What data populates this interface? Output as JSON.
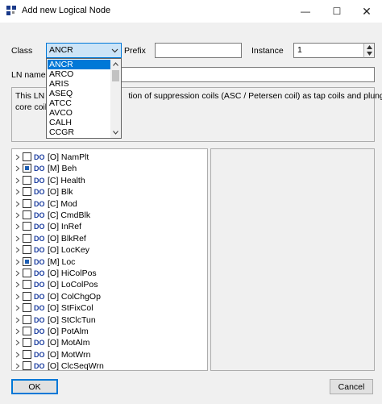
{
  "window": {
    "title": "Add new Logical Node",
    "minimize_glyph": "—",
    "maximize_glyph": "☐",
    "close_glyph": "✕"
  },
  "form": {
    "class_label": "Class",
    "class_value": "ANCR",
    "prefix_label": "Prefix",
    "prefix_value": "",
    "instance_label": "Instance",
    "instance_value": "1",
    "ln_name_label": "LN name",
    "ln_name_value": ""
  },
  "class_dropdown": {
    "options": [
      "ANCR",
      "ARCO",
      "ARIS",
      "ASEQ",
      "ATCC",
      "AVCO",
      "CALH",
      "CCGR"
    ],
    "selected": "ANCR"
  },
  "description": {
    "line1_start": "This LN s",
    "line1_end": "tion of suppression coils (ASC / Petersen coil) as tap coils and plunger",
    "line2": "core coils"
  },
  "tree": {
    "items": [
      {
        "tag": "DO",
        "text": "[O] NamPlt",
        "checked": "none"
      },
      {
        "tag": "DO",
        "text": "[M] Beh",
        "checked": "partial"
      },
      {
        "tag": "DO",
        "text": "[C] Health",
        "checked": "none"
      },
      {
        "tag": "DO",
        "text": "[O] Blk",
        "checked": "none"
      },
      {
        "tag": "DO",
        "text": "[C] Mod",
        "checked": "none"
      },
      {
        "tag": "DO",
        "text": "[C] CmdBlk",
        "checked": "none"
      },
      {
        "tag": "DO",
        "text": "[O] InRef",
        "checked": "none"
      },
      {
        "tag": "DO",
        "text": "[O] BlkRef",
        "checked": "none"
      },
      {
        "tag": "DO",
        "text": "[O] LocKey",
        "checked": "none"
      },
      {
        "tag": "DO",
        "text": "[M] Loc",
        "checked": "partial"
      },
      {
        "tag": "DO",
        "text": "[O] HiColPos",
        "checked": "none"
      },
      {
        "tag": "DO",
        "text": "[O] LoColPos",
        "checked": "none"
      },
      {
        "tag": "DO",
        "text": "[O] ColChgOp",
        "checked": "none"
      },
      {
        "tag": "DO",
        "text": "[O] StFixCol",
        "checked": "none"
      },
      {
        "tag": "DO",
        "text": "[O] StClcTun",
        "checked": "none"
      },
      {
        "tag": "DO",
        "text": "[O] PotAlm",
        "checked": "none"
      },
      {
        "tag": "DO",
        "text": "[O] MotAlm",
        "checked": "none"
      },
      {
        "tag": "DO",
        "text": "[O] MotWrn",
        "checked": "none"
      },
      {
        "tag": "DO",
        "text": "[O] ClcSeqWrn",
        "checked": "none"
      }
    ]
  },
  "buttons": {
    "ok_label": "OK",
    "cancel_label": "Cancel"
  }
}
